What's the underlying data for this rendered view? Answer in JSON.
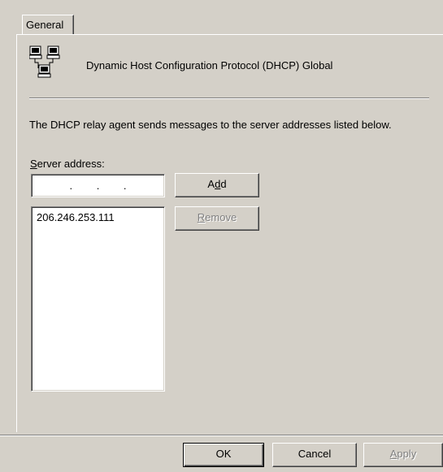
{
  "tabs": [
    {
      "label": "General",
      "selected": true
    }
  ],
  "header": {
    "icon": "network-computers-icon",
    "title": "Dynamic Host Configuration Protocol (DHCP) Global"
  },
  "description": "The DHCP relay agent sends messages to the server addresses listed below.",
  "server_address": {
    "label_key": "S",
    "label_rest": "erver address:",
    "input_value": ". . ."
  },
  "buttons": {
    "add": {
      "before": "A",
      "key": "d",
      "after": "d"
    },
    "remove": {
      "key": "R",
      "after": "emove",
      "disabled": true
    }
  },
  "server_list": [
    "206.246.253.111"
  ],
  "dialog_buttons": {
    "ok": "OK",
    "cancel": "Cancel",
    "apply_key": "A",
    "apply_rest": "pply",
    "apply_disabled": true
  },
  "colors": {
    "face": "#d4d0c8",
    "shadow": "#808080",
    "highlight": "#ffffff",
    "disabled_text": "#808080"
  }
}
